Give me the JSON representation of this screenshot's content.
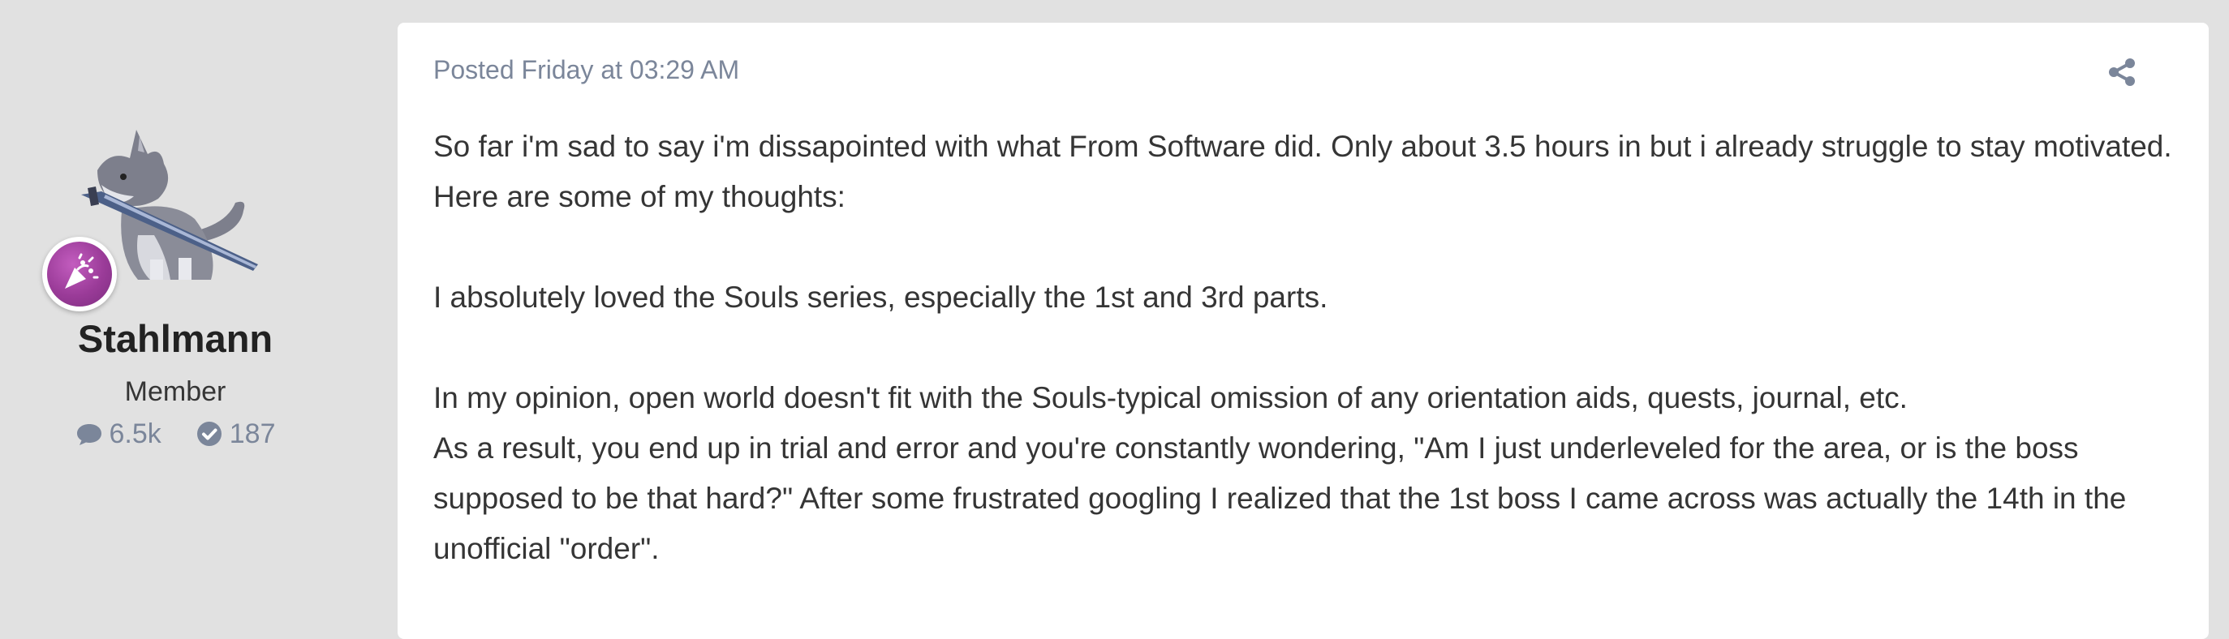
{
  "author": {
    "name": "Stahlmann",
    "role": "Member",
    "avatar": "wolf-with-sword-avatar",
    "rank_badge": "party-popper-icon",
    "stats": {
      "posts": "6.5k",
      "reputation": "187"
    }
  },
  "post": {
    "meta": "Posted Friday at 03:29 AM",
    "share_icon": "share-icon",
    "paragraphs": [
      "So far i'm sad to say i'm dissapointed with what From Software did. Only about 3.5 hours in but i already struggle to stay motivated. Here are some of my thoughts:",
      "I absolutely loved the Souls series, especially the 1st and 3rd parts.",
      "In my opinion, open world doesn't fit with the Souls-typical omission of any orientation aids, quests, journal, etc.",
      "As a result, you end up in trial and error and you're constantly wondering, \"Am I just underleveled for the area, or is the boss supposed to be that hard?\" After some frustrated googling I realized that the 1st boss I came across was actually the 14th in the unofficial \"order\"."
    ]
  },
  "colors": {
    "page_bg": "#e1e1e1",
    "card_bg": "#ffffff",
    "meta_text": "#7b869a",
    "body_text": "#353535",
    "badge_purple": "#9a3b98"
  }
}
